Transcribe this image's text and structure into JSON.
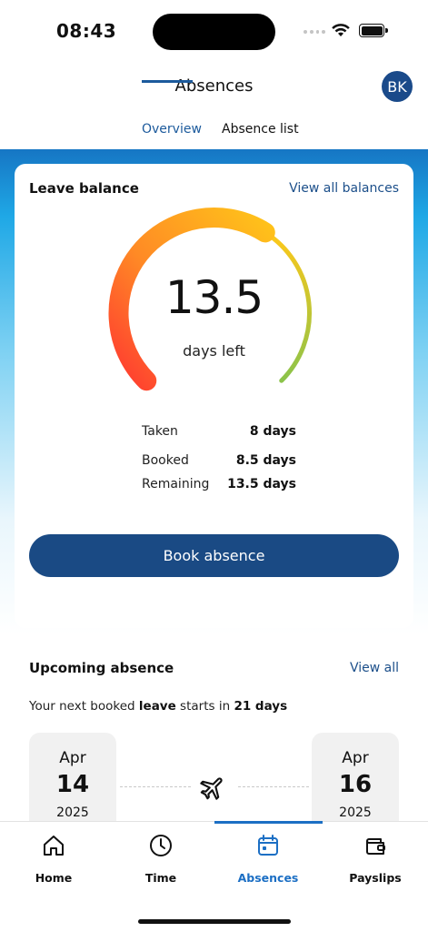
{
  "status_bar": {
    "time": "08:43"
  },
  "header": {
    "title": "Absences",
    "avatar_initials": "BK"
  },
  "tabs": [
    {
      "label": "Overview",
      "active": true
    },
    {
      "label": "Absence list",
      "active": false
    }
  ],
  "leave_balance": {
    "title": "Leave balance",
    "link": "View all balances",
    "gauge_value": "13.5",
    "gauge_label": "days left",
    "remaining_fraction": 0.62,
    "stats": [
      {
        "label": "Taken",
        "value": "8 days"
      },
      {
        "label": "Booked",
        "value": "8.5 days"
      },
      {
        "label": "Remaining",
        "value": "13.5 days"
      }
    ],
    "button": "Book absence"
  },
  "upcoming": {
    "title": "Upcoming absence",
    "link": "View all",
    "text_prefix": "Your next booked ",
    "text_type": "leave",
    "text_middle": " starts in ",
    "text_days": "21 days",
    "start": {
      "month": "Apr",
      "day": "14",
      "year": "2025"
    },
    "end": {
      "month": "Apr",
      "day": "16",
      "year": "2025"
    }
  },
  "nav": [
    {
      "label": "Home",
      "icon": "home-icon"
    },
    {
      "label": "Time",
      "icon": "clock-icon"
    },
    {
      "label": "Absences",
      "icon": "calendar-icon",
      "active": true
    },
    {
      "label": "Payslips",
      "icon": "wallet-icon"
    }
  ],
  "colors": {
    "primary": "#1a4a84",
    "accent": "#1c6fc4",
    "gauge_start": "#ff3b30",
    "gauge_mid": "#ffb020",
    "gauge_end": "#8bc34a"
  }
}
